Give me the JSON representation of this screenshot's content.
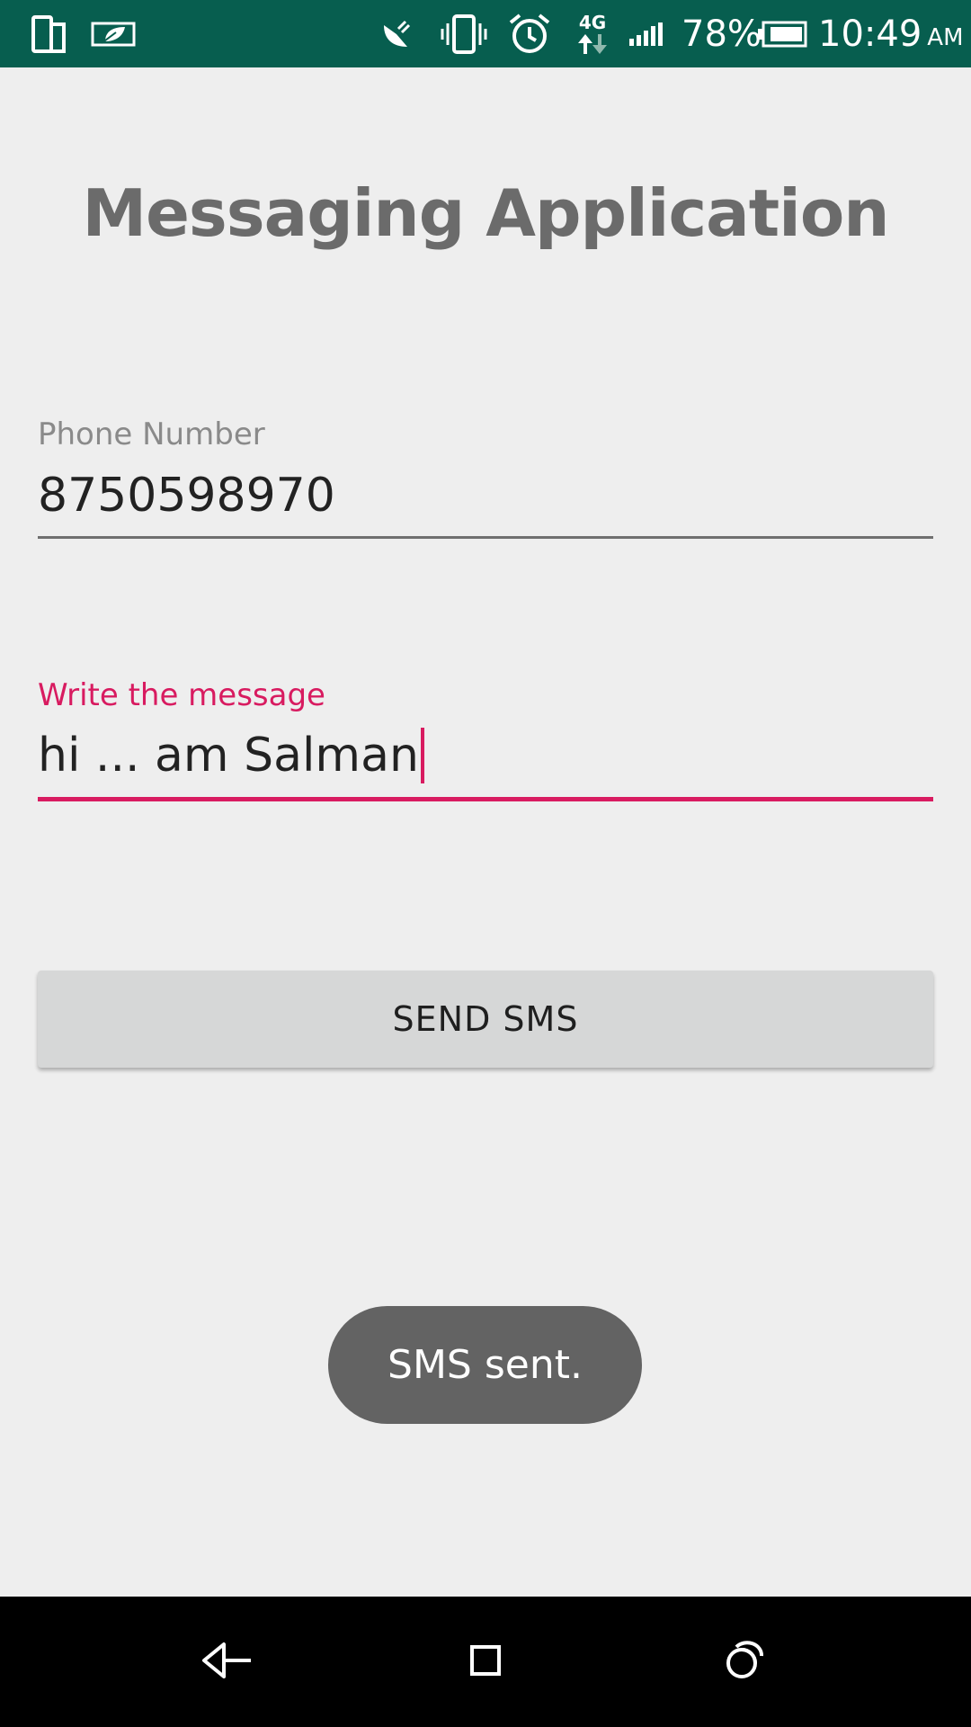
{
  "status_bar": {
    "icons": [
      "device-icon",
      "battery-saver-icon",
      "satellite-dish-icon",
      "vibrate-icon",
      "alarm-icon",
      "network-4g-icon",
      "signal-icon",
      "battery-icon"
    ],
    "network_type": "4G",
    "battery_percent": "78%",
    "time": "10:49",
    "ampm": "AM"
  },
  "app": {
    "title": "Messaging Application"
  },
  "phone_field": {
    "label": "Phone Number",
    "value": "8750598970"
  },
  "message_field": {
    "label": "Write the message",
    "value": "hi ... am Salman"
  },
  "send_button": {
    "label": "SEND SMS"
  },
  "toast": {
    "text": "SMS sent."
  },
  "nav_bar": {
    "icons": [
      "back-icon",
      "home-icon",
      "recents-icon"
    ]
  },
  "colors": {
    "status_bar": "#075e4f",
    "accent": "#d81b60",
    "background": "#eeeeee",
    "button": "#d6d7d7",
    "toast": "#636363"
  }
}
